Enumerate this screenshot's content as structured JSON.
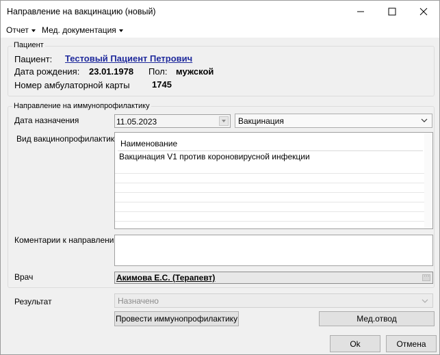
{
  "window": {
    "title": "Направление на вакцинацию  (новый)",
    "buttons": {
      "minimize": "minimize-icon",
      "maximize": "maximize-icon",
      "close": "close-icon"
    }
  },
  "menu": [
    {
      "label": "Отчет"
    },
    {
      "label": "Мед. документация"
    }
  ],
  "patient": {
    "group_label": "Пациент",
    "name_label": "Пациент:",
    "name": "Тестовый Пациент Петрович",
    "dob_label": "Дата рождения:",
    "dob": "23.01.1978",
    "sex_label": "Пол:",
    "sex": "мужской",
    "card_label": "Номер амбулаторной карты",
    "card": "1745"
  },
  "referral": {
    "group_label": "Направление на иммунопрофилактику",
    "date_label": "Дата назначения",
    "date_value": "11.05.2023",
    "type_value": "Вакцинация",
    "kind_label": "Вид вакцинопрофилактики",
    "table": {
      "header": "Наименование",
      "rows": [
        "Вакцинация V1 против короновирусной инфекции"
      ]
    },
    "comments_label": "Коментарии к направлению",
    "comments_value": "",
    "doctor_label": "Врач",
    "doctor_value": "Акимова Е.С. (Терапевт)"
  },
  "result": {
    "label": "Результат",
    "value": "Назначено"
  },
  "buttons": {
    "conduct": "Провести иммунопрофилактику",
    "med_exempt": "Мед.отвод",
    "ok": "Ok",
    "cancel": "Отмена"
  }
}
